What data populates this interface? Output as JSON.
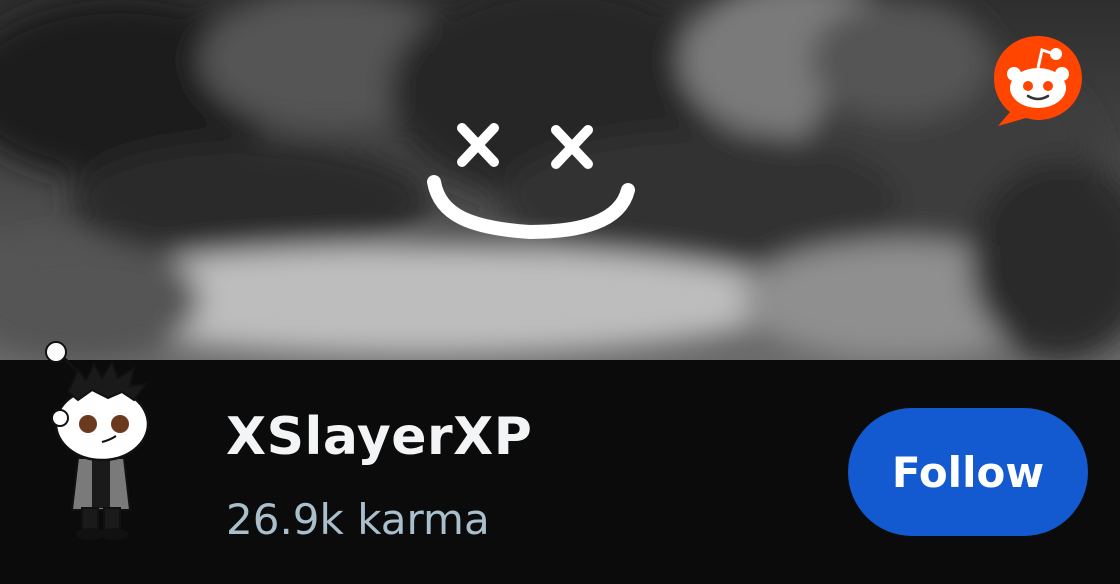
{
  "profile": {
    "username": "XSlayerXP",
    "karma": "26.9k karma",
    "avatar": "snoo-avatar-icon",
    "banner": "smiley-face-banner"
  },
  "actions": {
    "follow_label": "Follow"
  },
  "brand": {
    "logo": "reddit-logo-icon",
    "accent": "#ff4500",
    "button_color": "#1359d0"
  }
}
